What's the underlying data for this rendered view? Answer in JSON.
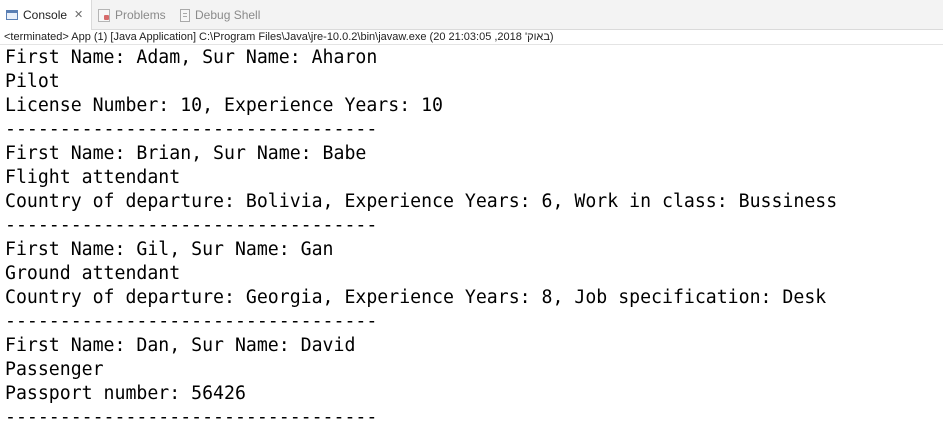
{
  "tabs": [
    {
      "label": "Console",
      "icon": "console-icon",
      "active": true
    },
    {
      "label": "Problems",
      "icon": "problems-icon",
      "active": false
    },
    {
      "label": "Debug Shell",
      "icon": "debug-shell-icon",
      "active": false
    }
  ],
  "status": {
    "text": "<terminated> App (1) [Java Application] C:\\Program Files\\Java\\jre-10.0.2\\bin\\javaw.exe (20 21:03:05 ,2018 'באוק)"
  },
  "console": {
    "lines": [
      "First Name: Adam, Sur Name: Aharon",
      "Pilot",
      "License Number: 10, Experience Years: 10",
      "----------------------------------",
      "First Name: Brian, Sur Name: Babe",
      "Flight attendant",
      "Country of departure: Bolivia, Experience Years: 6, Work in class: Bussiness",
      "----------------------------------",
      "First Name: Gil, Sur Name: Gan",
      "Ground attendant",
      "Country of departure: Georgia, Experience Years: 8, Job specification: Desk",
      "----------------------------------",
      "First Name: Dan, Sur Name: David",
      "Passenger",
      "Passport number: 56426",
      "----------------------------------"
    ]
  }
}
